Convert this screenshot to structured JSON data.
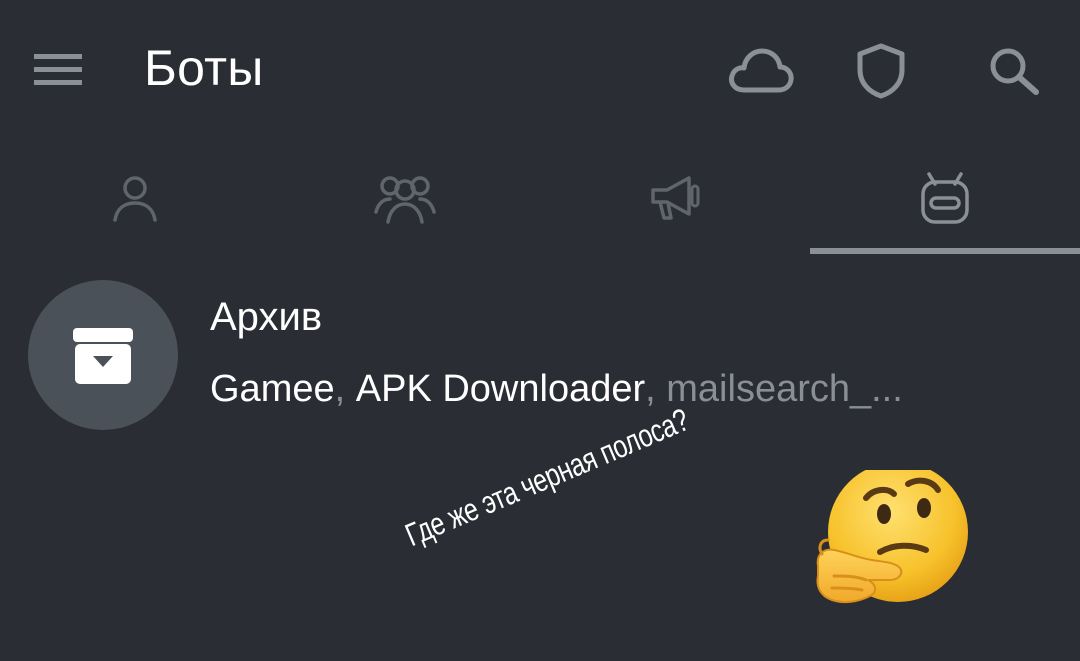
{
  "app_bar": {
    "title": "Боты",
    "menu_icon": "hamburger-menu-icon",
    "actions": [
      {
        "icon": "cloud-icon"
      },
      {
        "icon": "shield-icon"
      },
      {
        "icon": "search-icon"
      }
    ]
  },
  "tabs": [
    {
      "icon": "person-icon",
      "selected": false
    },
    {
      "icon": "group-icon",
      "selected": false
    },
    {
      "icon": "megaphone-icon",
      "selected": false
    },
    {
      "icon": "bot-icon",
      "selected": true
    }
  ],
  "archive": {
    "title": "Архив",
    "icon": "archive-box-icon",
    "chats": [
      "Gamee",
      "APK Downloader",
      "mailsearch_..."
    ],
    "separator": ", "
  },
  "overlay": {
    "annotation": "Где же эта черная полоса?",
    "emoji": "thinking-face-emoji"
  },
  "colors": {
    "background": "#2a2d34",
    "icon_gray": "#8b8f97",
    "text_primary": "#ffffff",
    "text_secondary": "#8a8f97",
    "avatar_bg": "#4a5158",
    "emoji_yellow": "#f7c22b"
  }
}
